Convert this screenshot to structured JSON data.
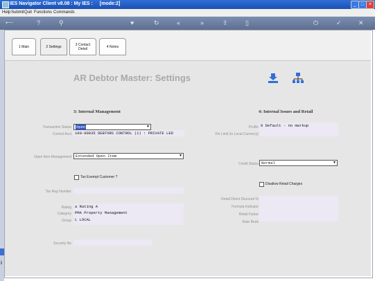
{
  "window": {
    "title": "IES Navigator Client v8.08 : My IES :",
    "mode": "[mode:2]"
  },
  "menu": [
    "Help",
    "Submit",
    "Quit",
    "Functions",
    "Commands"
  ],
  "tabs": [
    {
      "label": "1 Main"
    },
    {
      "label": "2 Settings"
    },
    {
      "label": "3 Contact Detail"
    },
    {
      "label": "4 Notes"
    }
  ],
  "page": {
    "title": "AR Debtor Master: Settings"
  },
  "left_section": {
    "heading": "3: Internal Management",
    "transaction_status": {
      "label": "Transaction Status",
      "value": "Open"
    },
    "control_acct": {
      "label": "Control Acct",
      "value": "100-00035 DEBTORS CONTROL (1) : PRIVATE LED"
    },
    "open_item_management": {
      "label": "Open Item Management",
      "value": "Extended Open Item"
    },
    "tax_exempt": {
      "label": "Tax Exempt Customer ?"
    },
    "tax_reg_number": {
      "label": "Tax Reg Number",
      "value": ""
    },
    "rating": {
      "label": "Rating",
      "value": "a Rating A"
    },
    "category": {
      "label": "Category",
      "value": "PMA Property Management"
    },
    "group": {
      "label": "Group",
      "value": "L LOCAL"
    },
    "security_no": {
      "label": "Security No",
      "value": ""
    }
  },
  "right_section": {
    "heading": "4: Internal Issues and Retail",
    "profile": {
      "label": "Profile",
      "value": "0 Default - no markup"
    },
    "fin_limit": {
      "label": "Fin Limit (in Local Currency)",
      "value": ""
    },
    "credit_status": {
      "label": "Credit Status",
      "value": "Normal"
    },
    "disallow_retail": {
      "label": "Disallow Retail Charges"
    },
    "retail_direct_discount": {
      "label": "Retail Direct Discount %",
      "value": ""
    },
    "formula_indicator": {
      "label": "Formula Indicator",
      "value": ""
    },
    "retail_factor": {
      "label": "Retail Factor",
      "value": ""
    },
    "rate_book": {
      "label": "Rate Book",
      "value": ""
    }
  }
}
